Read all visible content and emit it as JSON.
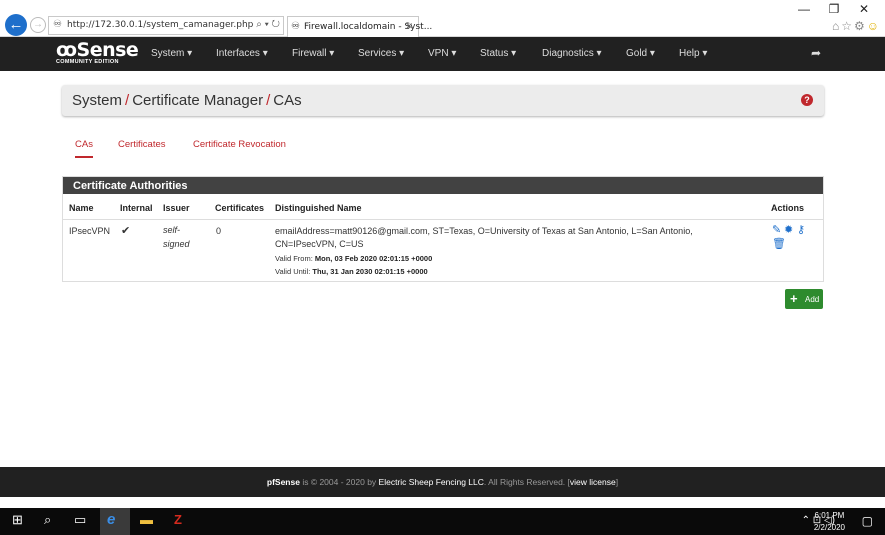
{
  "browser": {
    "url": "http://172.30.0.1/system_camanager.php",
    "tab_title": "Firewall.localdomain - Syst...",
    "tab_close": "✕",
    "addr_tools": "⌕ ▾ ↻",
    "minimize": "—",
    "restore": "❐",
    "close": "✕"
  },
  "logo": {
    "main": "Sense",
    "sub": "COMMUNITY EDITION"
  },
  "nav": {
    "items": [
      "System ▾",
      "Interfaces ▾",
      "Firewall ▾",
      "Services ▾",
      "VPN ▾",
      "Status ▾",
      "Diagnostics ▾",
      "Gold ▾",
      "Help ▾"
    ]
  },
  "breadcrumb": {
    "part1": "System",
    "part2": "Certificate Manager",
    "part3": "CAs",
    "sep": "/"
  },
  "tabs": [
    "CAs",
    "Certificates",
    "Certificate Revocation"
  ],
  "panel": {
    "title": "Certificate Authorities",
    "headers": [
      "Name",
      "Internal",
      "Issuer",
      "Certificates",
      "Distinguished Name",
      "Actions"
    ],
    "row": {
      "name": "IPsecVPN",
      "internal": "✔",
      "issuer_line1": "self-",
      "issuer_line2": "signed",
      "certificates": "0",
      "dn_line1": "emailAddress=matt90126@gmail.com, ST=Texas, O=University of Texas at San Antonio, L=San Antonio,",
      "dn_line2": "CN=IPsecVPN, C=US",
      "valid_from_label": "Valid From:",
      "valid_from": "Mon, 03 Feb 2020 02:01:15 +0000",
      "valid_until_label": "Valid Until:",
      "valid_until": "Thu, 31 Jan 2030 02:01:15 +0000"
    }
  },
  "add_button": "Add",
  "footer": {
    "brand": "pfSense",
    "text1": " is © 2004 - 2020 by ",
    "company": "Electric Sheep Fencing LLC",
    "text2": ". All Rights Reserved. [",
    "license": "view license",
    "text3": "]"
  },
  "taskbar": {
    "time": "6:01 PM",
    "date": "2/2/2020"
  },
  "colors": {
    "accent": "#c0282d",
    "navbar": "#212121",
    "add_green": "#2e8b2e",
    "action_blue": "#1e6fcb"
  }
}
